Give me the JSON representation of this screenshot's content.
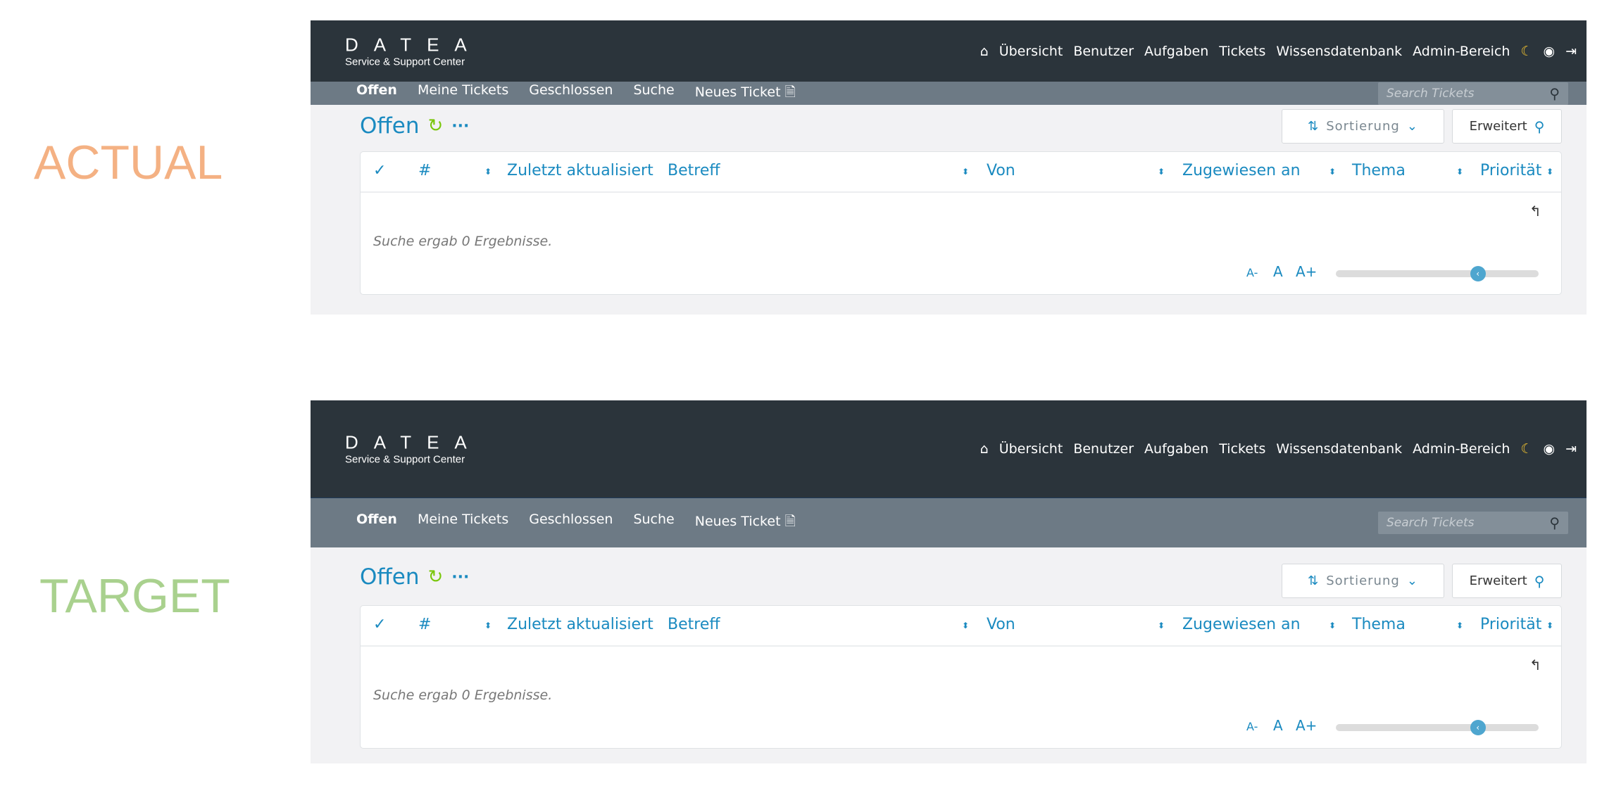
{
  "labels": {
    "actual": "ACTUAL",
    "target": "TARGET"
  },
  "logo": {
    "mark": "DATEA",
    "sub": "Service & Support Center"
  },
  "mainnav": [
    "Übersicht",
    "Benutzer",
    "Aufgaben",
    "Tickets",
    "Wissensdatenbank",
    "Admin-Bereich"
  ],
  "subnav": [
    "Offen",
    "Meine Tickets",
    "Geschlossen",
    "Suche",
    "Neues Ticket"
  ],
  "search": {
    "placeholder": "Search Tickets"
  },
  "page": {
    "title": "Offen",
    "sort_label": "Sortierung",
    "advanced_label": "Erweitert"
  },
  "table": {
    "columns": [
      "#",
      "Zuletzt aktualisiert",
      "Betreff",
      "Von",
      "Zugewiesen an",
      "Thema",
      "Priorität"
    ],
    "empty": "Suche ergab 0 Ergebnisse."
  },
  "fontsize": {
    "smaller": "A-",
    "normal": "A",
    "larger": "A+"
  },
  "slider": {
    "value": 0.7
  },
  "colors": {
    "header": "#2b343b",
    "subnav": "#6d7a85",
    "accent": "#1a8ac0",
    "refresh": "#7ac70c"
  }
}
